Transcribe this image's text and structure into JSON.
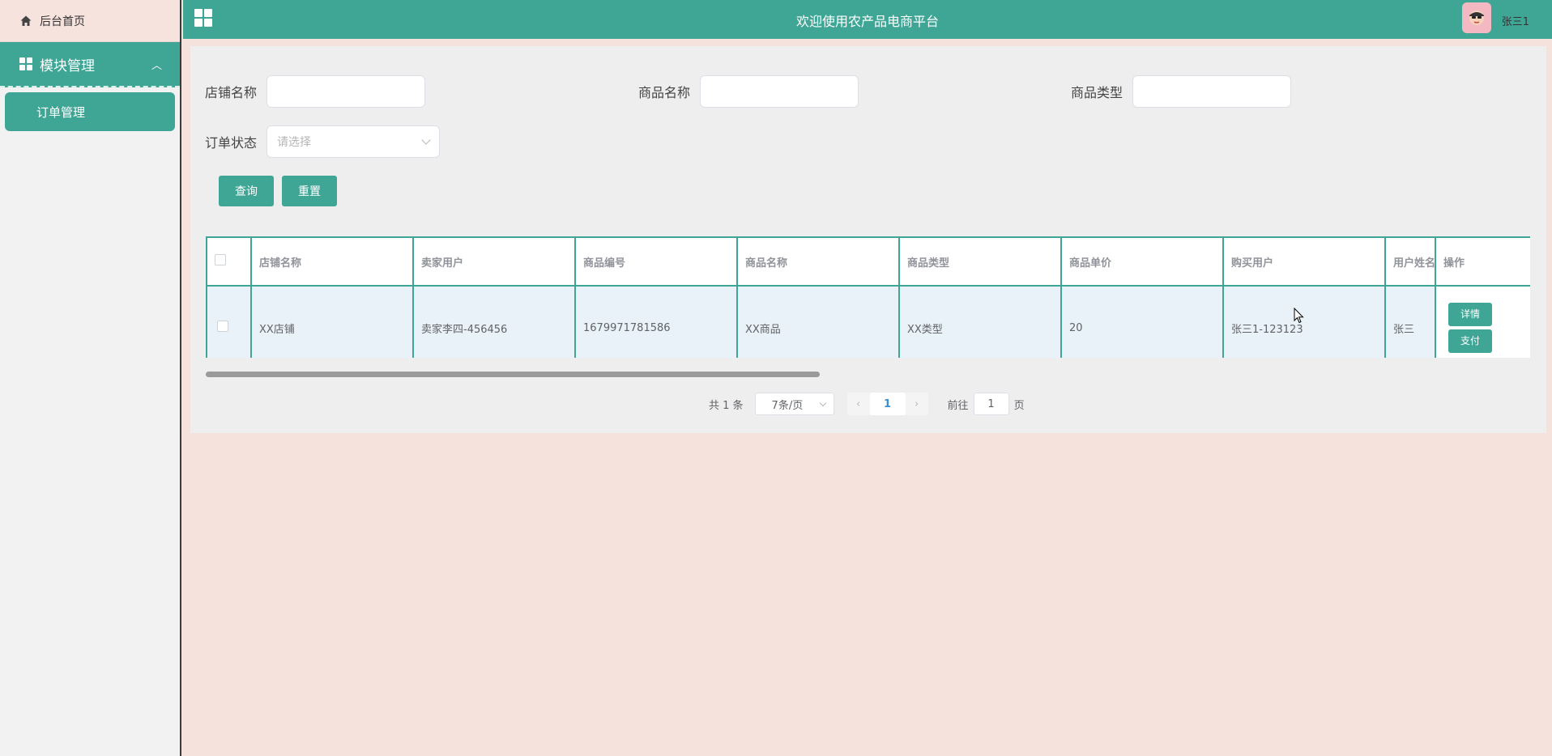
{
  "sidebar": {
    "home_label": "后台首页",
    "module_label": "模块管理",
    "sub_items": [
      {
        "label": "订单管理"
      }
    ]
  },
  "header": {
    "title": "欢迎使用农产品电商平台",
    "username": "张三1"
  },
  "search": {
    "shop_label": "店铺名称",
    "shop_value": "",
    "product_label": "商品名称",
    "product_value": "",
    "type_label": "商品类型",
    "type_value": "",
    "status_label": "订单状态",
    "status_placeholder": "请选择",
    "query_button": "查询",
    "reset_button": "重置"
  },
  "table": {
    "columns": [
      "店铺名称",
      "卖家用户",
      "商品编号",
      "商品名称",
      "商品类型",
      "商品单价",
      "购买用户",
      "用户姓名",
      "操作"
    ],
    "rows": [
      {
        "shop": "XX店铺",
        "seller": "卖家李四-456456",
        "product_no": "1679971781586",
        "product_name": "XX商品",
        "product_type": "XX类型",
        "price": "20",
        "buyer": "张三1-123123",
        "buyer_name": "张三",
        "detail_button": "详情",
        "pay_button": "支付"
      }
    ]
  },
  "pagination": {
    "total": "共 1 条",
    "page_size": "7条/页",
    "current_page": "1",
    "goto_label": "前往",
    "goto_value": "1",
    "page_suffix": "页"
  },
  "colors": {
    "accent": "#3fa696",
    "background": "#f5e2dd",
    "panel": "#eeeeee"
  }
}
